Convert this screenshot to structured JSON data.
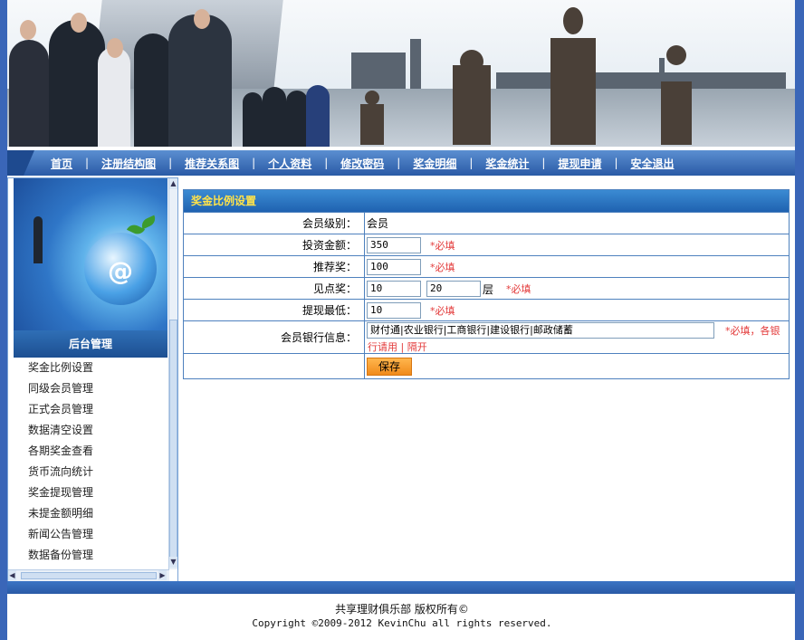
{
  "nav": {
    "items": [
      "首页",
      "注册结构图",
      "推荐关系图",
      "个人资料",
      "修改密码",
      "奖金明细",
      "奖金统计",
      "提现申请",
      "安全退出"
    ],
    "separator": "|"
  },
  "sidebar": {
    "title": "后台管理",
    "items": [
      "奖金比例设置",
      "同级会员管理",
      "正式会员管理",
      "数据清空设置",
      "各期奖金查看",
      "货币流向统计",
      "奖金提现管理",
      "未提金额明细",
      "新闻公告管理",
      "数据备份管理"
    ],
    "scroll_up": "▲",
    "scroll_down": "▼",
    "scroll_left": "◀",
    "scroll_right": "▶"
  },
  "form": {
    "title": "奖金比例设置",
    "member_level": {
      "label": "会员级别：",
      "value": "会员"
    },
    "investment": {
      "label": "投资金额：",
      "value": "350",
      "required": "*必填"
    },
    "referral": {
      "label": "推荐奖：",
      "value": "100",
      "required": "*必填"
    },
    "point": {
      "label": "见点奖：",
      "value": "10",
      "value2": "20",
      "unit": "层",
      "required": "*必填"
    },
    "min_withdraw": {
      "label": "提现最低：",
      "value": "10",
      "required": "*必填"
    },
    "bank_info": {
      "label": "会员银行信息：",
      "value": "财付通|农业银行|工商银行|建设银行|邮政储蓄",
      "required": "*必填，各银",
      "required_cont": "行请用 | 隔开"
    },
    "save_label": "保存"
  },
  "footer": {
    "line1": "共享理财俱乐部 版权所有©",
    "line2": "Copyright ©2009-2012 KevinChu all rights reserved."
  },
  "colors": {
    "nav_blue": "#2a5aa6",
    "title_yellow": "#ffe34a",
    "required_red": "#e33b3b",
    "save_orange": "#f08a1b"
  }
}
